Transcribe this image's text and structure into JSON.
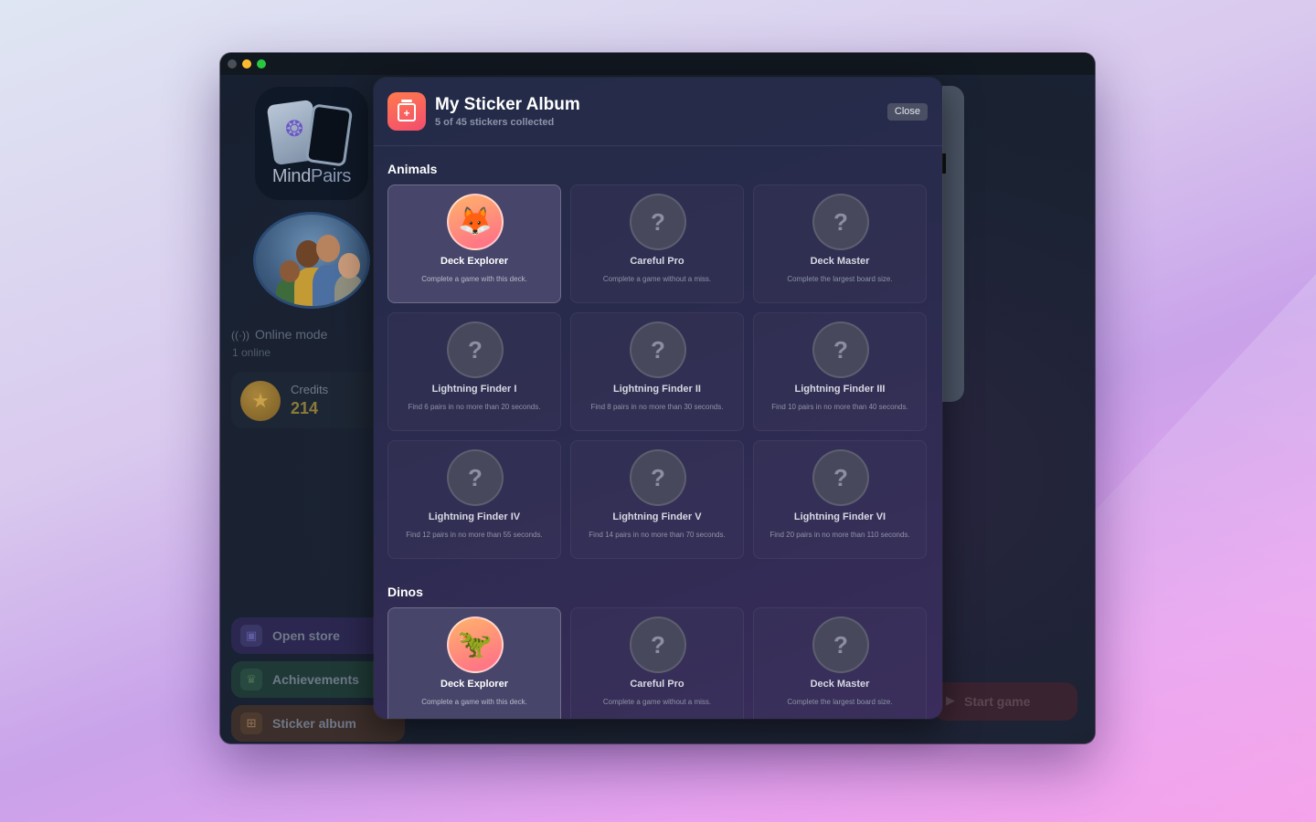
{
  "sidebar": {
    "logo_word_1": "Mind",
    "logo_word_2": "Pairs",
    "online_status": "Online mode",
    "online_count": "1 online",
    "credits_label": "Credits",
    "credits_value": "214",
    "buttons": {
      "store": "Open store",
      "achievements": "Achievements",
      "sticker_album": "Sticker album"
    }
  },
  "main": {
    "start_game": "Start game"
  },
  "modal": {
    "title": "My Sticker Album",
    "subtitle": "5 of 45 stickers collected",
    "close_label": "Close",
    "sections": [
      {
        "title": "Animals",
        "stickers": [
          {
            "name": "Deck Explorer",
            "desc": "Complete a game with this deck.",
            "unlocked": true,
            "badge": "🦊"
          },
          {
            "name": "Careful Pro",
            "desc": "Complete a game without a miss.",
            "unlocked": false,
            "badge": "?"
          },
          {
            "name": "Deck Master",
            "desc": "Complete the largest board size.",
            "unlocked": false,
            "badge": "?"
          },
          {
            "name": "Lightning Finder I",
            "desc": "Find 6 pairs in no more than 20 seconds.",
            "unlocked": false,
            "badge": "?"
          },
          {
            "name": "Lightning Finder II",
            "desc": "Find 8 pairs in no more than 30 seconds.",
            "unlocked": false,
            "badge": "?"
          },
          {
            "name": "Lightning Finder III",
            "desc": "Find 10 pairs in no more than 40 seconds.",
            "unlocked": false,
            "badge": "?"
          },
          {
            "name": "Lightning Finder IV",
            "desc": "Find 12 pairs in no more than 55 seconds.",
            "unlocked": false,
            "badge": "?"
          },
          {
            "name": "Lightning Finder V",
            "desc": "Find 14 pairs in no more than 70 seconds.",
            "unlocked": false,
            "badge": "?"
          },
          {
            "name": "Lightning Finder VI",
            "desc": "Find 20 pairs in no more than 110 seconds.",
            "unlocked": false,
            "badge": "?"
          }
        ]
      },
      {
        "title": "Dinos",
        "stickers": [
          {
            "name": "Deck Explorer",
            "desc": "Complete a game with this deck.",
            "unlocked": true,
            "badge": "🦖"
          },
          {
            "name": "Careful Pro",
            "desc": "Complete a game without a miss.",
            "unlocked": false,
            "badge": "?"
          },
          {
            "name": "Deck Master",
            "desc": "Complete the largest board size.",
            "unlocked": false,
            "badge": "?"
          }
        ]
      }
    ]
  },
  "colors": {
    "accent_orange": "#ff7a4d",
    "accent_pink": "#f24d6e",
    "modal_bg": "#2a2b4e",
    "coin_gold": "#a8853c"
  },
  "icons": {
    "album": "sticker-album-icon",
    "locked": "question-mark-icon",
    "coin": "star-coin-icon",
    "online": "wifi-signal-icon",
    "store": "bag-icon",
    "achievements": "trophy-icon",
    "play": "play-icon"
  }
}
